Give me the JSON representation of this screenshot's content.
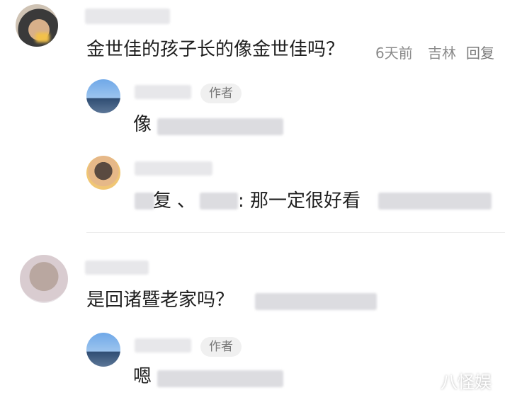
{
  "comments": [
    {
      "text": "金世佳的孩子长的像金世佳吗？",
      "time": "6天前",
      "location": "吉林",
      "reply_label": "回复",
      "replies": [
        {
          "tag": "作者",
          "text": "像"
        },
        {
          "text_prefix": "复",
          "separator": "、",
          "text_suffix": ": 那一定很好看"
        }
      ]
    },
    {
      "text": "是回诸暨老家吗？",
      "replies": [
        {
          "tag": "作者",
          "text": "嗯"
        }
      ]
    }
  ],
  "watermark": "八怪娱"
}
